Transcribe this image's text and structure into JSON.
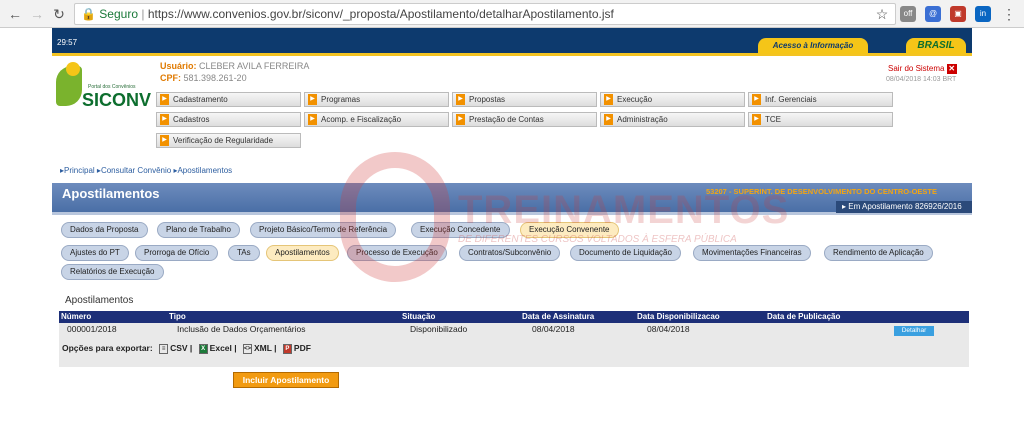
{
  "browser": {
    "secure_label": "Seguro",
    "url": "https://www.convenios.gov.br/siconv/_proposta/Apostilamento/detalharApostilamento.jsf"
  },
  "topbar": {
    "time": "29:57",
    "acesso_label": "Acesso à Informação",
    "brasil_label": "BRASIL"
  },
  "logo": {
    "small_text": "Portal dos Convênios",
    "name": "SICONV"
  },
  "user": {
    "usuario_label": "Usuário:",
    "usuario_value": "CLEBER AVILA FERREIRA",
    "cpf_label": "CPF:",
    "cpf_value": "581.398.261-20"
  },
  "session": {
    "sair_label": "Sair do Sistema",
    "timestamp": "08/04/2018 14:03 BRT"
  },
  "menu": [
    "Cadastramento",
    "Programas",
    "Propostas",
    "Execução",
    "Inf. Gerenciais",
    "Cadastros",
    "Acomp. e Fiscalização",
    "Prestação de Contas",
    "Administração",
    "TCE",
    "Verificação de Regularidade"
  ],
  "breadcrumb": [
    "Principal",
    "Consultar Convênio",
    "Apostilamentos"
  ],
  "header": {
    "title": "Apostilamentos",
    "org": "53207 - SUPERINT. DE DESENVOLVIMENTO DO CENTRO-OESTE",
    "sub": "Em Apostilamento 826926/2016"
  },
  "tabs_row1": [
    "Dados da Proposta",
    "Plano de Trabalho",
    "Projeto Básico/Termo de Referência",
    "Execução Concedente",
    "Execução Convenente"
  ],
  "tabs_row2": [
    "Ajustes do PT",
    "Prorroga de Ofício",
    "TAs",
    "Apostilamentos",
    "Processo de Execução",
    "Contratos/Subconvênio",
    "Documento de Liquidação",
    "Movimentações Financeiras",
    "Rendimento de Aplicação"
  ],
  "tabs_row3": [
    "Relatórios de Execução"
  ],
  "section_title": "Apostilamentos",
  "table": {
    "columns": [
      "Número",
      "Tipo",
      "Situação",
      "Data de Assinatura",
      "Data Disponibilizacao",
      "Data de Publicação"
    ],
    "row": {
      "numero": "000001/2018",
      "tipo": "Inclusão de Dados Orçamentários",
      "situacao": "Disponibilizado",
      "assinatura": "08/04/2018",
      "disponibilizacao": "08/04/2018",
      "publicacao": "",
      "action": "Detalhar"
    }
  },
  "export": {
    "label": "Opções para exportar:",
    "options": [
      "CSV",
      "Excel",
      "XML",
      "PDF"
    ]
  },
  "incluir_label": "Incluir Apostilamento",
  "watermark": {
    "title": "TREINAMENTOS",
    "subtitle": "DE DIFERENTES CURSOS VOLTADOS À ESFERA PÚBLICA"
  }
}
